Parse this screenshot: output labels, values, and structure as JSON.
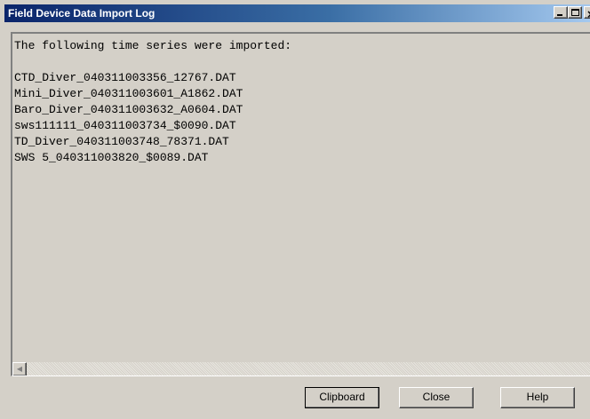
{
  "window": {
    "title": "Field Device Data Import Log",
    "controls": {
      "minimize": "_",
      "maximize": "□",
      "close": "×"
    }
  },
  "log": {
    "header": "The following time series were imported:",
    "entries": [
      "CTD_Diver_040311003356_12767.DAT",
      "Mini_Diver_040311003601_A1862.DAT",
      "Baro_Diver_040311003632_A0604.DAT",
      "sws111111_040311003734_$0090.DAT",
      "TD_Diver_040311003748_78371.DAT",
      "SWS 5_040311003820_$0089.DAT"
    ]
  },
  "buttons": {
    "clipboard": "Clipboard",
    "close": "Close",
    "help": "Help"
  },
  "colors": {
    "title_start": "#0a246a",
    "title_end": "#a6caf0",
    "face": "#d4d0c8"
  }
}
